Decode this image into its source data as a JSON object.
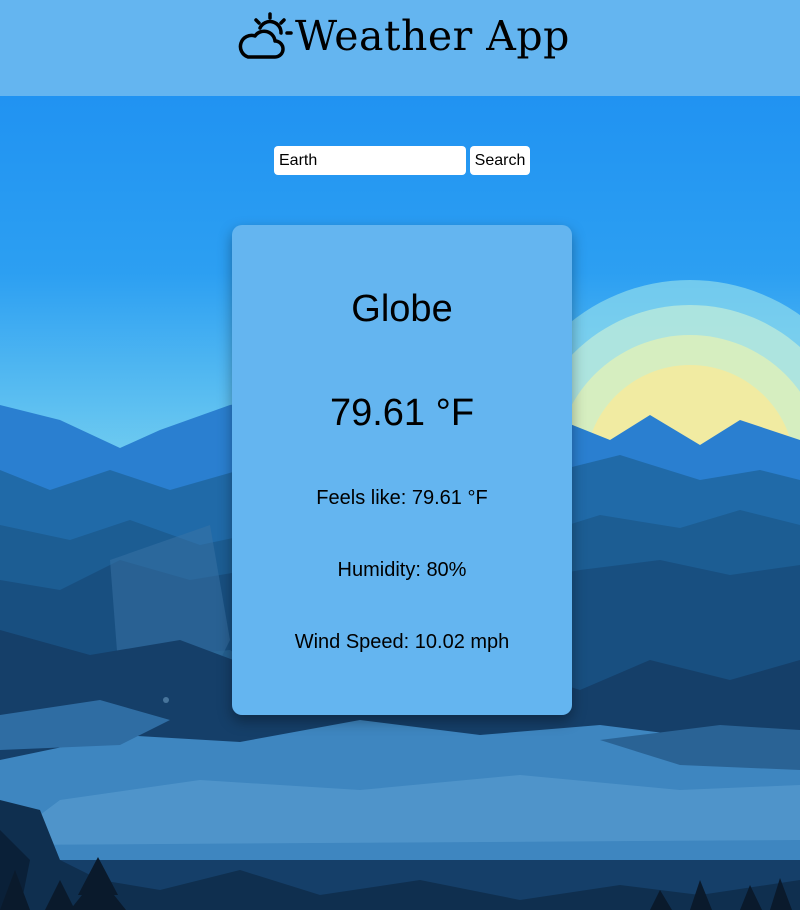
{
  "header": {
    "title": "Weather App",
    "icon": "sun-cloud-icon"
  },
  "search": {
    "value": "Earth",
    "button_label": "Search"
  },
  "weather": {
    "city": "Globe",
    "temperature": "79.61 °F",
    "feels_like": "Feels like: 79.61 °F",
    "humidity": "Humidity: 80%",
    "wind_speed": "Wind Speed: 10.02 mph"
  },
  "colors": {
    "header_bg": "#64b5f0",
    "card_bg": "#64b5f0",
    "sky_top": "#1a8cf2",
    "sun": "#f5ea9a"
  }
}
